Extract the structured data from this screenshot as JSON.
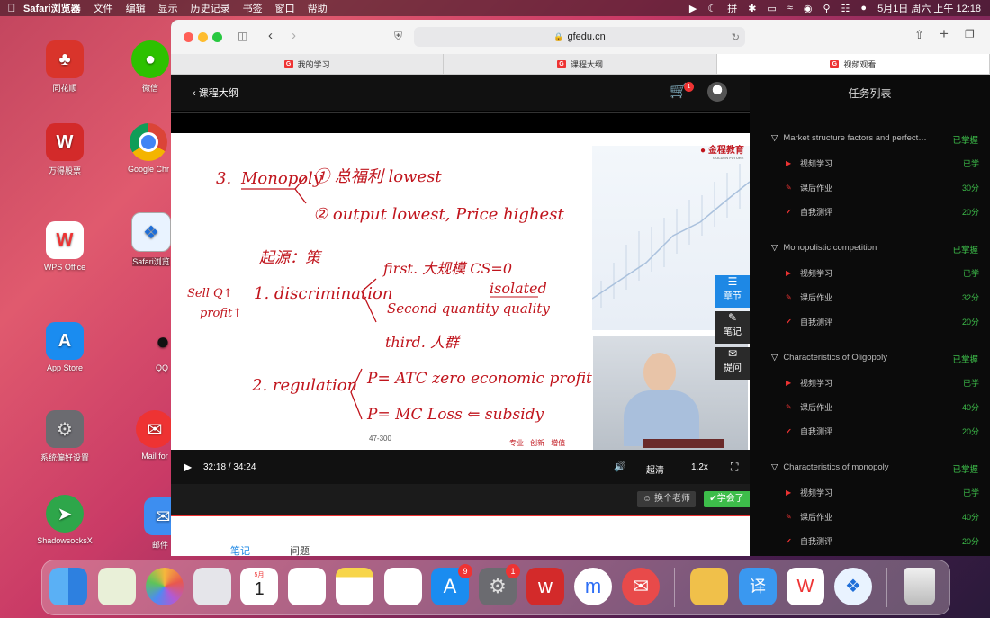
{
  "menubar": {
    "app_name": "Safari浏览器",
    "items": [
      "文件",
      "编辑",
      "显示",
      "历史记录",
      "书签",
      "窗口",
      "帮助"
    ],
    "clock": "5月1日 周六 上午 12:18"
  },
  "desktop": {
    "icons": [
      {
        "label": "同花顺",
        "name": "tonghuashun"
      },
      {
        "label": "微信",
        "name": "wechat"
      },
      {
        "label": "万得股票",
        "name": "wind-stock"
      },
      {
        "label": "Google Chr",
        "name": "google-chrome"
      },
      {
        "label": "WPS Office",
        "name": "wps-office"
      },
      {
        "label": "Safari浏览",
        "name": "safari"
      },
      {
        "label": "App Store",
        "name": "app-store"
      },
      {
        "label": "QQ",
        "name": "qq"
      },
      {
        "label": "系统偏好设置",
        "name": "system-preferences"
      },
      {
        "label": "Mail for",
        "name": "mail-for"
      },
      {
        "label": "ShadowsocksX",
        "name": "shadowsocksx"
      },
      {
        "label": "邮件",
        "name": "mail"
      }
    ]
  },
  "browser": {
    "url": "gfedu.cn",
    "tabs": [
      "我的学习",
      "课程大纲",
      "视频观看"
    ],
    "active_tab": 2
  },
  "page": {
    "back_label": "课程大纲",
    "cart_count": "1",
    "time": "32:18 / 34:24",
    "progress": 0.94,
    "quality": "超清",
    "speed": "1.2x",
    "slide_page": "47-300",
    "brand": "金程教育",
    "brand_en": "GOLDEN FUTURE",
    "slogan": "专业 · 创新 · 增值",
    "side_buttons": [
      "章节",
      "笔记",
      "提问"
    ],
    "change_teacher": "换个老师",
    "learned": "学会了",
    "bottom_tabs": [
      "笔记",
      "问题"
    ]
  },
  "slide": {
    "l1_num": "3.",
    "l1_main": "Monopoly",
    "l1_a": "① 总福利 lowest",
    "l1_b": "② output lowest, Price highest",
    "l2": "起源：策",
    "side_note_1": "Sell Q↑",
    "side_note_2": "profit↑",
    "l3": "1. discrimination",
    "l3_a": "first. 大规模  CS=0",
    "l3_a2": "isolated",
    "l3_b": "Second  quantity  quality",
    "l3_c": "third. 人群",
    "l4": "2. regulation",
    "l4_a": "P= ATC  zero economic profit",
    "l4_b": "P= MC  Loss ⇐ subsidy"
  },
  "sidebar": {
    "title": "任务列表",
    "sections": [
      {
        "name": "Market structure factors and perfect…",
        "status": "已掌握",
        "rows": [
          {
            "label": "视频学习",
            "value": "已学"
          },
          {
            "label": "课后作业",
            "value": "30分"
          },
          {
            "label": "自我测评",
            "value": "20分"
          }
        ]
      },
      {
        "name": "Monopolistic competition",
        "status": "已掌握",
        "rows": [
          {
            "label": "视频学习",
            "value": "已学"
          },
          {
            "label": "课后作业",
            "value": "32分"
          },
          {
            "label": "自我测评",
            "value": "20分"
          }
        ]
      },
      {
        "name": "Characteristics of Oligopoly",
        "status": "已掌握",
        "rows": [
          {
            "label": "视频学习",
            "value": "已学"
          },
          {
            "label": "课后作业",
            "value": "40分"
          },
          {
            "label": "自我测评",
            "value": "20分"
          }
        ]
      },
      {
        "name": "Characteristics of monopoly",
        "status": "已掌握",
        "rows": [
          {
            "label": "视频学习",
            "value": "已学"
          },
          {
            "label": "课后作业",
            "value": "40分"
          },
          {
            "label": "自我测评",
            "value": "20分"
          }
        ]
      }
    ]
  },
  "dock": {
    "calendar_month": "5月",
    "calendar_day": "1",
    "appstore_badge": "9",
    "settings_badge": "1"
  },
  "colors": {
    "accent_green": "#3dbd4a",
    "accent_red": "#e33333",
    "accent_blue": "#1e88e5"
  }
}
